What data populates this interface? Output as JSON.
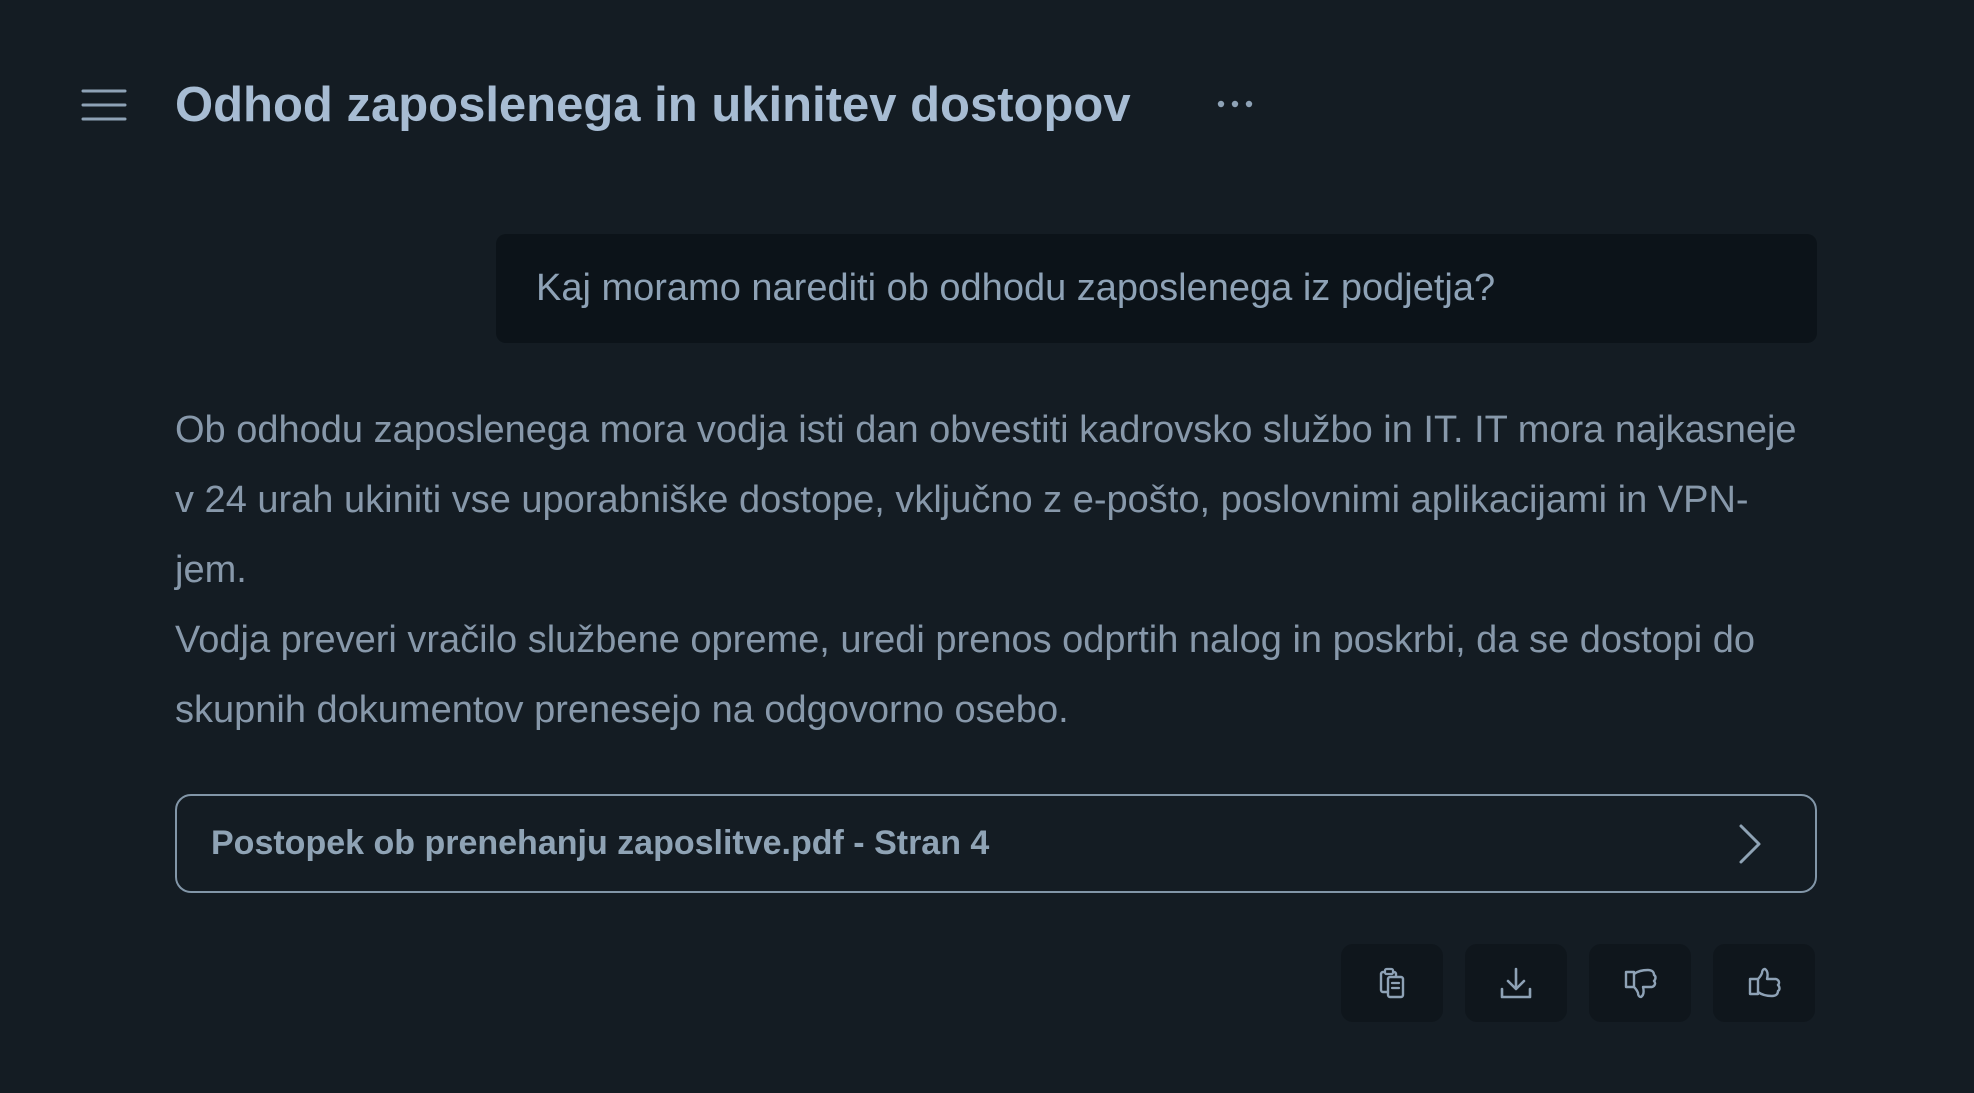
{
  "header": {
    "menu_icon": "hamburger-menu-icon",
    "title": "Odhod zaposlenega in ukinitev dostopov",
    "more_icon": "more-options-icon"
  },
  "conversation": {
    "user_message": "Kaj moramo narediti ob odhodu zaposlenega iz podjetja?",
    "answer_paragraphs": [
      "Ob odhodu zaposlenega mora vodja isti dan obvestiti kadrovsko službo in IT. IT mora najkasneje v 24 urah ukiniti vse uporabniške dostope, vključno z e-pošto, poslovnimi aplikacijami in VPN-jem.",
      "Vodja preveri vračilo službene opreme, uredi prenos odprtih nalog in poskrbi, da se dostopi do skupnih dokumentov prenesejo na odgovorno osebo."
    ],
    "source": {
      "label": "Postopek ob prenehanju zaposlitve.pdf - Stran 4",
      "icon": "chevron-right-icon"
    }
  },
  "actions": [
    {
      "icon": "copy-icon"
    },
    {
      "icon": "download-icon"
    },
    {
      "icon": "thumbs-down-icon"
    },
    {
      "icon": "thumbs-up-icon"
    }
  ],
  "colors": {
    "background": "#141c23",
    "user_bubble": "#0c1319",
    "title": "#a7bcd3",
    "text": "#8798aa",
    "border": "#8296a8"
  }
}
